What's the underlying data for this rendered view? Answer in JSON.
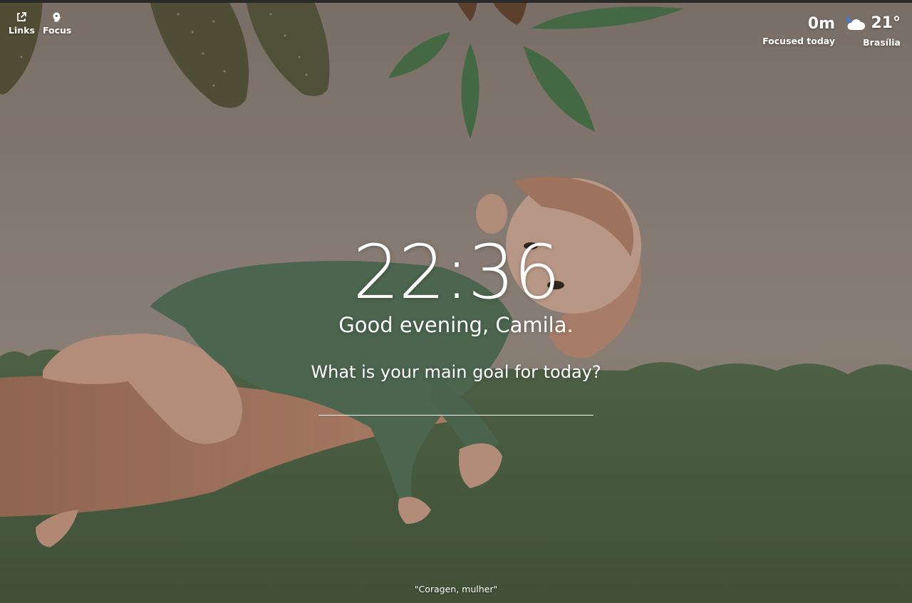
{
  "nav": {
    "links_label": "Links",
    "focus_label": "Focus"
  },
  "focus_stats": {
    "value": "0m",
    "label": "Focused today"
  },
  "weather": {
    "temperature": "21°",
    "city": "Brasília",
    "icon": "cloud-moon-icon"
  },
  "main": {
    "time": "22:36",
    "greeting": "Good evening, Camila.",
    "question": "What is your main goal for today?",
    "goal_input_value": ""
  },
  "quote": "\"Coragen, mulher\"",
  "colors": {
    "wall": "#948478",
    "wall_green": "#566b48",
    "leaf_green": "#4f7a4e",
    "onesie": "#58765c",
    "skin": "#c99a82"
  }
}
